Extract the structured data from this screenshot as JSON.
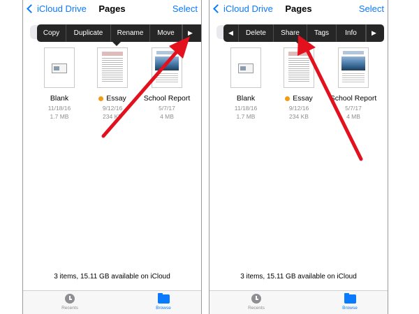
{
  "accent_color": "#0a7aff",
  "arrow_color": "#e3101e",
  "screens": [
    {
      "nav": {
        "back": "iCloud Drive",
        "title": "Pages",
        "select": "Select"
      },
      "menu": {
        "items": [
          "Copy",
          "Duplicate",
          "Rename",
          "Move"
        ],
        "right_arrow": "▶"
      },
      "files": [
        {
          "name": "Blank",
          "date": "11/18/16",
          "size": "1.7 MB"
        },
        {
          "name": "Essay",
          "date": "9/12/16",
          "size": "234 KB",
          "tag_color": "#f39c12"
        },
        {
          "name": "School Report",
          "date": "5/7/17",
          "size": "4 MB"
        }
      ],
      "storage": "3 items, 15.11 GB available on iCloud",
      "tabs": {
        "recents": "Recents",
        "browse": "Browse"
      }
    },
    {
      "nav": {
        "back": "iCloud Drive",
        "title": "Pages",
        "select": "Select"
      },
      "menu": {
        "left_arrow": "◀",
        "items": [
          "Delete",
          "Share",
          "Tags",
          "Info"
        ],
        "right_arrow": "▶"
      },
      "files": [
        {
          "name": "Blank",
          "date": "11/18/16",
          "size": "1.7 MB"
        },
        {
          "name": "Essay",
          "date": "9/12/16",
          "size": "234 KB",
          "tag_color": "#f39c12"
        },
        {
          "name": "School Report",
          "date": "5/7/17",
          "size": "4 MB"
        }
      ],
      "storage": "3 items, 15.11 GB available on iCloud",
      "tabs": {
        "recents": "Recents",
        "browse": "Browse"
      }
    }
  ]
}
